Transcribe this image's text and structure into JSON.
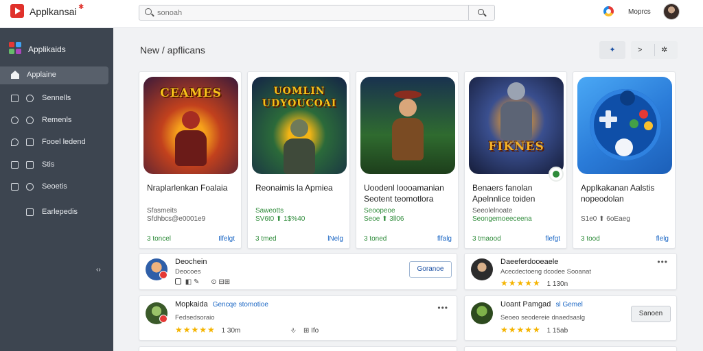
{
  "header": {
    "app_name": "Applkansai",
    "search": {
      "value": "",
      "placeholder": "sonoah"
    },
    "user_name": "Moprcs"
  },
  "sidebar": {
    "brand": "Applikaids",
    "items": [
      {
        "label": "Applaine",
        "active": true
      },
      {
        "label": "Sennells"
      },
      {
        "label": "Remenls"
      },
      {
        "label": "Fooel ledend"
      },
      {
        "label": "Stis"
      },
      {
        "label": "Seoetis"
      },
      {
        "label": "Earlepedis"
      }
    ],
    "collapse_glyph": "‹›"
  },
  "main": {
    "title": "New / apflicans",
    "toolbar": {
      "pin_icon": "pin-icon",
      "share_label": ">",
      "settings_icon": "gear-icon"
    }
  },
  "apps": [
    {
      "art_title": "CEAMES",
      "name": "Nraplarlenkan Foalaia",
      "sub": "Sfasmeits",
      "rating": "Sfdhbcs@e0001e9",
      "foot_left": "3 toncel",
      "foot_right": "Ilfelgt",
      "colors": {
        "bg": "#b8342a",
        "accent": "#f7a21b"
      }
    },
    {
      "art_title": "UOMLIN UDYOUCOAI",
      "name": "Reonaimis la Apmiea",
      "sub": "Saweotts",
      "rating": "SV6t0 ⬆ 1$%40",
      "foot_left": "3 tmed",
      "foot_right": "lNelg",
      "colors": {
        "bg": "#1f3a6b",
        "accent": "#f3b515"
      }
    },
    {
      "art_title": "",
      "name": "Uoodenl loooamanian Seotent teomotlora",
      "sub": "Seoopeoe",
      "rating": "Seoe ⬆ 3ll06",
      "foot_left": "3 toned",
      "foot_right": "flfalg",
      "colors": {
        "bg": "#2f6b2f",
        "accent": "#e0a33a"
      }
    },
    {
      "art_title": "FIKNES",
      "name": "Benaers fanolan Apelnnlice toiden",
      "sub": "Seeolelnoate",
      "rating": "Seongemoeeceena",
      "foot_left": "3 tmaood",
      "foot_right": "flefgt",
      "colors": {
        "bg": "#3a4f8f",
        "accent": "#f4a02a"
      }
    },
    {
      "art_title": "",
      "name": "Applkakanan Aalstis nopeodolan",
      "sub": "",
      "rating": "S1e0 ⬆ 6oEaeg",
      "foot_left": "3 tood",
      "foot_right": "flelg",
      "colors": {
        "bg": "#2a7bd8",
        "accent": "#0f4fa8"
      }
    }
  ],
  "reviews": [
    {
      "title": "Deochein",
      "link": "",
      "sub": "Deocoes",
      "meta": "⊙ ⊟⊞",
      "stars": "",
      "rating": "",
      "button": "Goranoe",
      "more": ""
    },
    {
      "title": "Daeeferdooeaele",
      "link": "",
      "sub": "Acecdectoeng dcodee Sooanat",
      "meta": "",
      "stars": "★★★★★",
      "rating": "1 130n",
      "button": "",
      "more": "•••"
    },
    {
      "title": "Mopkaida",
      "link": "Gencqe stomotioe",
      "sub": "Fedsedsoraio",
      "meta": "",
      "stars": "★★★★★",
      "rating": "1 30m",
      "button": "",
      "more": "•••",
      "extra": "⊞ Ifo"
    },
    {
      "title": "Uoant Pamgad",
      "link": "sl Gemel",
      "sub": "Seoeo seodereie dnaedsaslg",
      "meta": "",
      "stars": "★★★★★",
      "rating": "1 15ab",
      "button": "Sanoen",
      "more": "•••"
    }
  ],
  "colors": {
    "sidebar_bg": "#3d4550",
    "sidebar_active": "#58606b",
    "accent_blue": "#1a66c4",
    "accent_green": "#2e8b3a",
    "star": "#f5b400",
    "brand_red": "#e0312b"
  }
}
